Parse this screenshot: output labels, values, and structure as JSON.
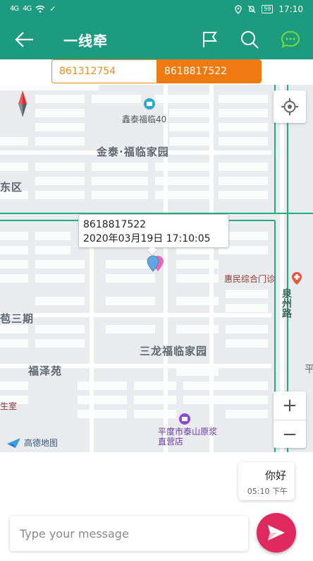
{
  "status_bar": {
    "signal1": "4G",
    "signal2": "4G",
    "battery": "59",
    "time": "17:10"
  },
  "app_bar": {
    "title": "一线牵",
    "icons": [
      "back-arrow-icon",
      "flag-icon",
      "search-icon",
      "chat-bubble-icon"
    ],
    "accent_color": "#1d9b7e",
    "chat_icon_color": "#6ddc3c"
  },
  "tabs": [
    {
      "label": "861312754",
      "active": false
    },
    {
      "label": "8618817522",
      "active": true
    }
  ],
  "map": {
    "labels": {
      "poi_top": "鑫泰福临40",
      "area1": "金泰·福临家园",
      "area_left": "东区",
      "area_phase3": "苞三期",
      "clinic": "惠民综合门诊",
      "road": "泉州路",
      "area2": "三龙福临家园",
      "area3": "福泽苑",
      "room": "生室",
      "edge": "平",
      "shop": "平度市泰山原浆直营店"
    },
    "callout": {
      "phone": "8618817522",
      "datetime": "2020年03月19日 17:10:05"
    },
    "logo_text": "高德地图",
    "zoom_in": "+",
    "zoom_out": "−"
  },
  "chat": {
    "messages": [
      {
        "text": "你好",
        "time": "05:10 下午"
      }
    ],
    "input_placeholder": "Type your message",
    "send_color": "#e02860"
  }
}
